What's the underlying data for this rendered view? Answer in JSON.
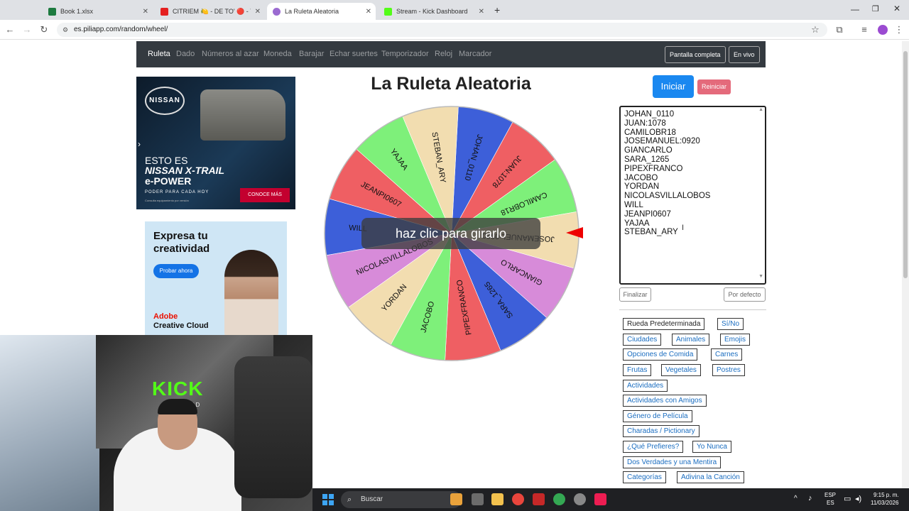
{
  "browser": {
    "tabs": [
      {
        "label": "Book 1.xlsx",
        "color": "#1d7a3f"
      },
      {
        "label": "CITRIEM 🍋 - DE TO' 🔴 - YouT",
        "color": "#e52020"
      },
      {
        "label": "La Ruleta Aleatoria",
        "color": "#9b6bd1"
      },
      {
        "label": "Stream - Kick Dashboard",
        "color": "#53fc18"
      }
    ],
    "url": "es.piliapp.com/random/wheel/"
  },
  "nav": {
    "links": [
      "Ruleta",
      "Dado",
      "Números al azar",
      "Moneda",
      "Barajar",
      "Echar suertes",
      "Temporizador",
      "Reloj",
      "Marcador"
    ],
    "fullscreen": "Pantalla completa",
    "live": "En vivo"
  },
  "ad1": {
    "brand": "NISSAN",
    "line1": "ESTO ES",
    "line2": "NISSAN X-TRAIL",
    "line3": "e-POWER",
    "tagline": "PODER PARA CADA HOY",
    "cta": "CONOCE MÁS",
    "fine": "Consulta equipamiento por versión"
  },
  "ad2": {
    "headline": "Expresa tu creatividad",
    "cta": "Probar ahora",
    "brand1": "Adobe",
    "brand2": "Creative Cloud"
  },
  "main": {
    "title": "La Ruleta Aleatoria",
    "overlay": "haz clic para girarlo",
    "start": "Iniciar",
    "reset": "Reiniciar",
    "finish": "Finalizar",
    "default": "Por defecto"
  },
  "wheel": {
    "segments": [
      {
        "label": "JOHAN_0110",
        "color": "#3d5fd9"
      },
      {
        "label": "JUAN:1078",
        "color": "#ef5f63"
      },
      {
        "label": "CAMILOBR18",
        "color": "#7ef07a"
      },
      {
        "label": "JOSEMANUEL:0920",
        "color": "#f2ddb0"
      },
      {
        "label": "GIANCARLO",
        "color": "#d78bd9"
      },
      {
        "label": "SARA_1265",
        "color": "#3d5fd9"
      },
      {
        "label": "PIPEXFRANCO",
        "color": "#ef5f63"
      },
      {
        "label": "JACOBO",
        "color": "#7ef07a"
      },
      {
        "label": "YORDAN",
        "color": "#f2ddb0"
      },
      {
        "label": "NICOLASVILLALOBOS",
        "color": "#d78bd9"
      },
      {
        "label": "WILL",
        "color": "#3d5fd9"
      },
      {
        "label": "JEANPI0607",
        "color": "#ef5f63"
      },
      {
        "label": "YAJAA",
        "color": "#7ef07a"
      },
      {
        "label": "STEBAN_ARY",
        "color": "#f2ddb0"
      }
    ]
  },
  "names": [
    "JOHAN_0110",
    "JUAN:1078",
    "CAMILOBR18",
    "JOSEMANUEL:0920",
    "GIANCARLO",
    "SARA_1265",
    "PIPEXFRANCO",
    "JACOBO",
    "YORDAN",
    "NICOLASVILLALOBOS",
    "WILL",
    "JEANPI0607",
    "YAJAA",
    "STEBAN_ARY"
  ],
  "presets": [
    {
      "label": "Rueda Predeterminada"
    },
    {
      "label": "Sí/No"
    },
    {
      "label": "Ciudades"
    },
    {
      "label": "Animales"
    },
    {
      "label": "Emojis"
    },
    {
      "label": "Opciones de Comida"
    },
    {
      "label": "Carnes"
    },
    {
      "label": "Frutas"
    },
    {
      "label": "Vegetales"
    },
    {
      "label": "Postres"
    },
    {
      "label": "Actividades"
    },
    {
      "label": "Actividades con Amigos"
    },
    {
      "label": "Género de Película"
    },
    {
      "label": "Charadas / Pictionary"
    },
    {
      "label": "¿Qué Prefieres?"
    },
    {
      "label": "Yo Nunca"
    },
    {
      "label": "Dos Verdades y una Mentira"
    },
    {
      "label": "Categorías"
    },
    {
      "label": "Adivina la Canción"
    }
  ],
  "webcam": {
    "sign": "KICK",
    "sign_sub": "FREE WORLD"
  },
  "taskbar": {
    "search": "Buscar",
    "lang1": "ESP",
    "lang2": "ES",
    "time": "9:15 p. m.",
    "date": "11/03/2026"
  }
}
